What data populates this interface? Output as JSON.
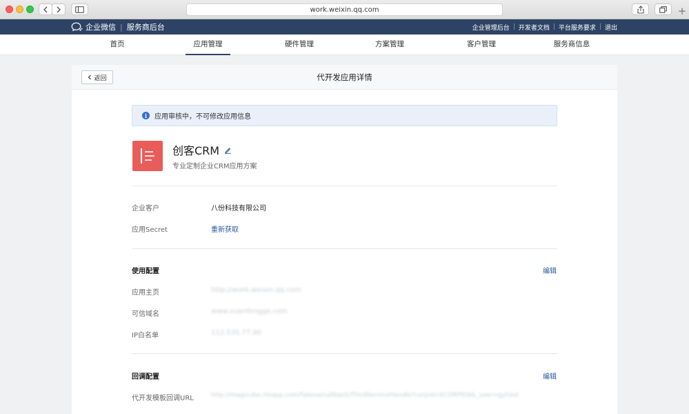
{
  "browser": {
    "url": "work.weixin.qq.com",
    "new_tab": "+"
  },
  "topbar": {
    "brand_name": "企业微信",
    "brand_sub": "服务商后台",
    "links": [
      "企业管理后台",
      "开发者文档",
      "平台服务要求",
      "退出"
    ]
  },
  "nav": {
    "items": [
      "首页",
      "应用管理",
      "硬件管理",
      "方案管理",
      "客户管理",
      "服务商信息"
    ],
    "active": "应用管理"
  },
  "header": {
    "back_label": "返回",
    "title": "代开发应用详情"
  },
  "notice": {
    "text": "应用审核中，不可修改应用信息"
  },
  "app": {
    "name": "创客CRM",
    "description": "专业定制企业CRM应用方案"
  },
  "basic": {
    "customer_label": "企业客户",
    "customer_value": "八份科技有限公司",
    "secret_label": "应用Secret",
    "secret_action": "重新获取"
  },
  "usage_config": {
    "title": "使用配置",
    "edit_label": "编辑",
    "homepage_label": "应用主页",
    "homepage_value": "http://work.weixin.qq.com",
    "domain_label": "可信域名",
    "domain_value": "www.xuanfengge.com",
    "ip_label": "IP白名单",
    "ip_value": "112.535.77.90"
  },
  "callback_config": {
    "title": "回调配置",
    "edit_label": "编辑",
    "url_label": "代开发模板回调URL",
    "url_value": "http://magicube.rtxapp.com/fakeoa/callback/ThirdServiceHandle?corpid=$CORPID$&_user=gyhest"
  }
}
